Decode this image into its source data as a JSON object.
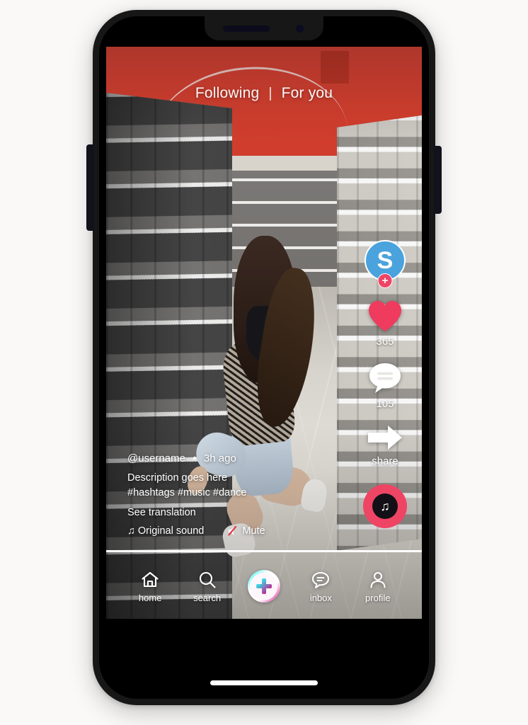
{
  "app": {
    "title": "Short Video Feed Mockup"
  },
  "top_tabs": {
    "following_label": "Following",
    "separator": "|",
    "for_you_label": "For you"
  },
  "rail": {
    "avatar_letter": "S",
    "avatar_follow_badge": "+",
    "avatar_color": "#4aa3dc",
    "like_count": "365",
    "like_color": "#ee3b5e",
    "comment_count": "105",
    "share_label": "share",
    "music_disc_color": "#ef4565",
    "music_note": "♫"
  },
  "caption": {
    "username": "@username",
    "timestamp": "3h ago",
    "description": "Description goes here",
    "hashtags": "#hashtags #music #dance",
    "see_translation": "See translation",
    "sound_note": "♫",
    "sound_label": "Original sound",
    "mute_label": "Mute",
    "mute_slash_color": "#e03a4e"
  },
  "progress": {
    "percent": 100
  },
  "bottom_nav": {
    "items": [
      {
        "label": "home",
        "icon": "home-icon"
      },
      {
        "label": "search",
        "icon": "search-icon"
      },
      {
        "label": "",
        "icon": "create-plus-icon"
      },
      {
        "label": "inbox",
        "icon": "inbox-icon"
      },
      {
        "label": "profile",
        "icon": "profile-icon"
      }
    ]
  },
  "device": {
    "frame_color": "#171717",
    "background_color": "#faf9f8"
  }
}
